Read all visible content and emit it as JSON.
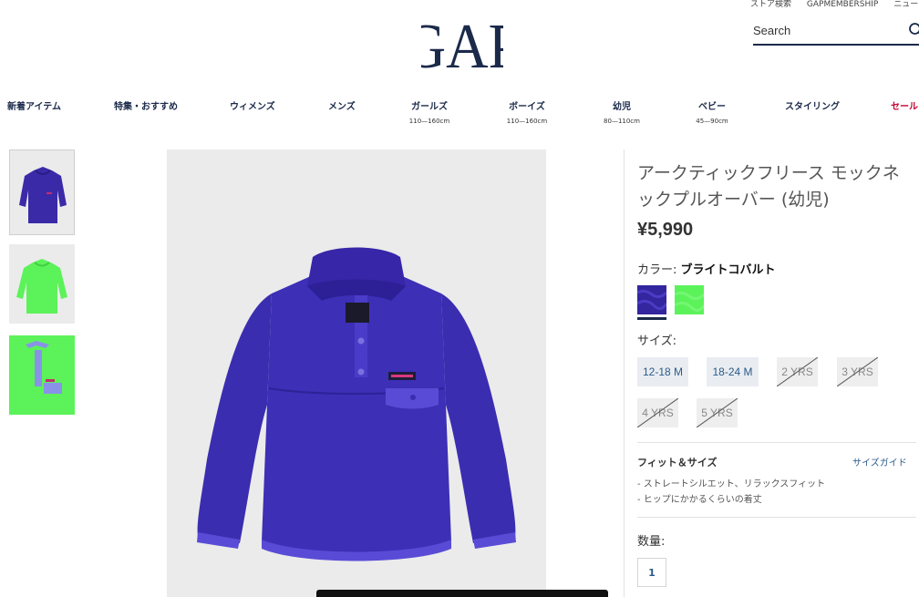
{
  "header": {
    "top_links": [
      "ストア検索",
      "GAPMEMBERSHIP",
      "ニュー"
    ],
    "logo_text": "GAP",
    "search_placeholder": "Search"
  },
  "nav": {
    "items": [
      {
        "label": "新着アイテム",
        "sub": ""
      },
      {
        "label": "特集・おすすめ",
        "sub": ""
      },
      {
        "label": "ウィメンズ",
        "sub": ""
      },
      {
        "label": "メンズ",
        "sub": ""
      },
      {
        "label": "ガールズ",
        "sub": "110—160cm"
      },
      {
        "label": "ボーイズ",
        "sub": "110—160cm"
      },
      {
        "label": "幼児",
        "sub": "80—110cm"
      },
      {
        "label": "ベビー",
        "sub": "45—90cm"
      },
      {
        "label": "スタイリング",
        "sub": ""
      },
      {
        "label": "セール",
        "sub": ""
      }
    ]
  },
  "product": {
    "title": "アークティックフリース モックネックプルオーバー (幼児)",
    "price": "¥5,990",
    "color_label": "カラー:",
    "color_value": "ブライトコバルト",
    "swatches": [
      {
        "name": "ブライトコバルト",
        "color": "#3a2aa8"
      },
      {
        "name": "green",
        "color": "#5cf25a"
      }
    ],
    "size_label": "サイズ:",
    "sizes": [
      {
        "label": "12-18 M",
        "available": true
      },
      {
        "label": "18-24 M",
        "available": true
      },
      {
        "label": "2 YRS",
        "available": false
      },
      {
        "label": "3 YRS",
        "available": false
      },
      {
        "label": "4 YRS",
        "available": false
      },
      {
        "label": "5 YRS",
        "available": false
      }
    ],
    "fit_title": "フィット＆サイズ",
    "size_guide": "サイズガイド",
    "fit_lines": [
      "- ストレートシルエット、リラックスフィット",
      "- ヒップにかかるくらいの着丈"
    ],
    "quantity_label": "数量:",
    "quantity_value": "1"
  },
  "colors": {
    "brand_navy": "#1b2a4a",
    "sale_red": "#c3002f",
    "cobalt": "#3a2aa8",
    "neon_green": "#5cf25a"
  }
}
